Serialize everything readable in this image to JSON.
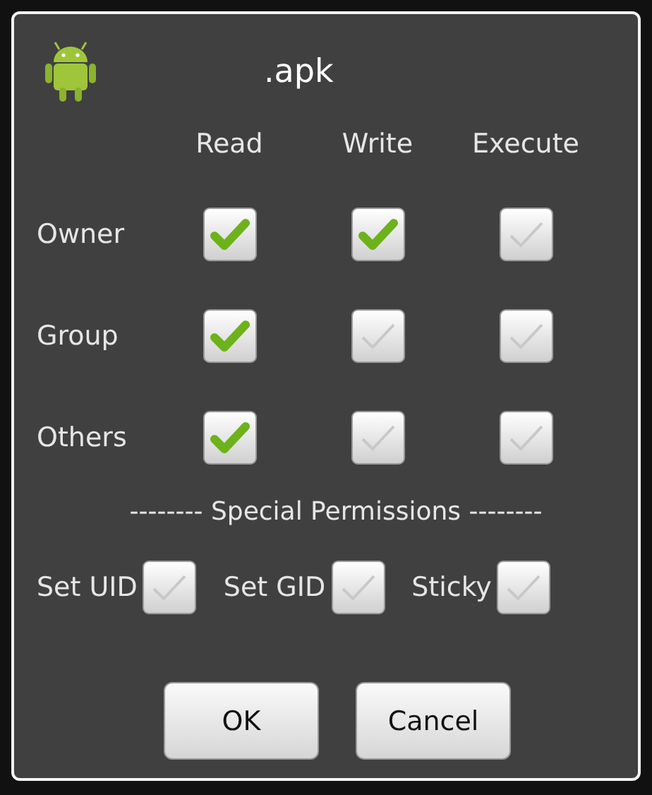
{
  "dialog": {
    "title": ".apk",
    "columns": [
      "Read",
      "Write",
      "Execute"
    ],
    "rows": [
      {
        "label": "Owner",
        "permissions": [
          {
            "checked": true
          },
          {
            "checked": true
          },
          {
            "checked": false
          }
        ]
      },
      {
        "label": "Group",
        "permissions": [
          {
            "checked": true
          },
          {
            "checked": false
          },
          {
            "checked": false
          }
        ]
      },
      {
        "label": "Others",
        "permissions": [
          {
            "checked": true
          },
          {
            "checked": false
          },
          {
            "checked": false
          }
        ]
      }
    ],
    "special_title": "-------- Special Permissions --------",
    "special": [
      {
        "label": "Set UID",
        "checked": false
      },
      {
        "label": "Set GID",
        "checked": false
      },
      {
        "label": "Sticky",
        "checked": false
      }
    ],
    "buttons": [
      "OK",
      "Cancel"
    ]
  }
}
